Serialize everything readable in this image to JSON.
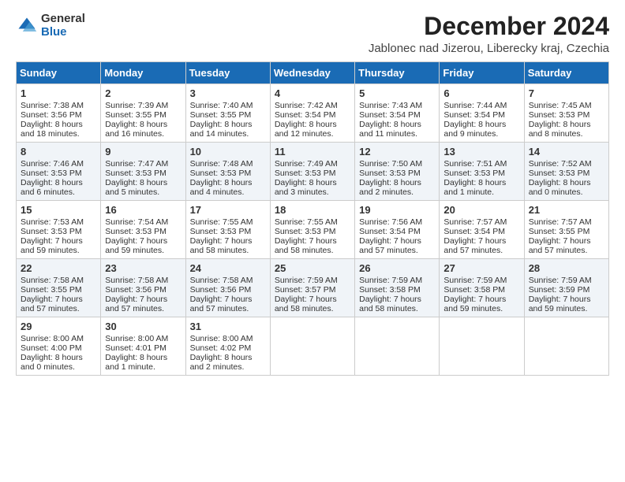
{
  "logo": {
    "general": "General",
    "blue": "Blue"
  },
  "title": "December 2024",
  "subtitle": "Jablonec nad Jizerou, Liberecky kraj, Czechia",
  "days": [
    "Sunday",
    "Monday",
    "Tuesday",
    "Wednesday",
    "Thursday",
    "Friday",
    "Saturday"
  ],
  "weeks": [
    [
      {
        "num": "1",
        "rise": "7:38 AM",
        "set": "3:56 PM",
        "daylight": "8 hours and 18 minutes"
      },
      {
        "num": "2",
        "rise": "7:39 AM",
        "set": "3:55 PM",
        "daylight": "8 hours and 16 minutes"
      },
      {
        "num": "3",
        "rise": "7:40 AM",
        "set": "3:55 PM",
        "daylight": "8 hours and 14 minutes"
      },
      {
        "num": "4",
        "rise": "7:42 AM",
        "set": "3:54 PM",
        "daylight": "8 hours and 12 minutes"
      },
      {
        "num": "5",
        "rise": "7:43 AM",
        "set": "3:54 PM",
        "daylight": "8 hours and 11 minutes"
      },
      {
        "num": "6",
        "rise": "7:44 AM",
        "set": "3:54 PM",
        "daylight": "8 hours and 9 minutes"
      },
      {
        "num": "7",
        "rise": "7:45 AM",
        "set": "3:53 PM",
        "daylight": "8 hours and 8 minutes"
      }
    ],
    [
      {
        "num": "8",
        "rise": "7:46 AM",
        "set": "3:53 PM",
        "daylight": "8 hours and 6 minutes"
      },
      {
        "num": "9",
        "rise": "7:47 AM",
        "set": "3:53 PM",
        "daylight": "8 hours and 5 minutes"
      },
      {
        "num": "10",
        "rise": "7:48 AM",
        "set": "3:53 PM",
        "daylight": "8 hours and 4 minutes"
      },
      {
        "num": "11",
        "rise": "7:49 AM",
        "set": "3:53 PM",
        "daylight": "8 hours and 3 minutes"
      },
      {
        "num": "12",
        "rise": "7:50 AM",
        "set": "3:53 PM",
        "daylight": "8 hours and 2 minutes"
      },
      {
        "num": "13",
        "rise": "7:51 AM",
        "set": "3:53 PM",
        "daylight": "8 hours and 1 minute"
      },
      {
        "num": "14",
        "rise": "7:52 AM",
        "set": "3:53 PM",
        "daylight": "8 hours and 0 minutes"
      }
    ],
    [
      {
        "num": "15",
        "rise": "7:53 AM",
        "set": "3:53 PM",
        "daylight": "7 hours and 59 minutes"
      },
      {
        "num": "16",
        "rise": "7:54 AM",
        "set": "3:53 PM",
        "daylight": "7 hours and 59 minutes"
      },
      {
        "num": "17",
        "rise": "7:55 AM",
        "set": "3:53 PM",
        "daylight": "7 hours and 58 minutes"
      },
      {
        "num": "18",
        "rise": "7:55 AM",
        "set": "3:53 PM",
        "daylight": "7 hours and 58 minutes"
      },
      {
        "num": "19",
        "rise": "7:56 AM",
        "set": "3:54 PM",
        "daylight": "7 hours and 57 minutes"
      },
      {
        "num": "20",
        "rise": "7:57 AM",
        "set": "3:54 PM",
        "daylight": "7 hours and 57 minutes"
      },
      {
        "num": "21",
        "rise": "7:57 AM",
        "set": "3:55 PM",
        "daylight": "7 hours and 57 minutes"
      }
    ],
    [
      {
        "num": "22",
        "rise": "7:58 AM",
        "set": "3:55 PM",
        "daylight": "7 hours and 57 minutes"
      },
      {
        "num": "23",
        "rise": "7:58 AM",
        "set": "3:56 PM",
        "daylight": "7 hours and 57 minutes"
      },
      {
        "num": "24",
        "rise": "7:58 AM",
        "set": "3:56 PM",
        "daylight": "7 hours and 57 minutes"
      },
      {
        "num": "25",
        "rise": "7:59 AM",
        "set": "3:57 PM",
        "daylight": "7 hours and 58 minutes"
      },
      {
        "num": "26",
        "rise": "7:59 AM",
        "set": "3:58 PM",
        "daylight": "7 hours and 58 minutes"
      },
      {
        "num": "27",
        "rise": "7:59 AM",
        "set": "3:58 PM",
        "daylight": "7 hours and 59 minutes"
      },
      {
        "num": "28",
        "rise": "7:59 AM",
        "set": "3:59 PM",
        "daylight": "7 hours and 59 minutes"
      }
    ],
    [
      {
        "num": "29",
        "rise": "8:00 AM",
        "set": "4:00 PM",
        "daylight": "8 hours and 0 minutes"
      },
      {
        "num": "30",
        "rise": "8:00 AM",
        "set": "4:01 PM",
        "daylight": "8 hours and 1 minute"
      },
      {
        "num": "31",
        "rise": "8:00 AM",
        "set": "4:02 PM",
        "daylight": "8 hours and 2 minutes"
      },
      null,
      null,
      null,
      null
    ]
  ],
  "labels": {
    "sunrise": "Sunrise:",
    "sunset": "Sunset:",
    "daylight": "Daylight:"
  }
}
